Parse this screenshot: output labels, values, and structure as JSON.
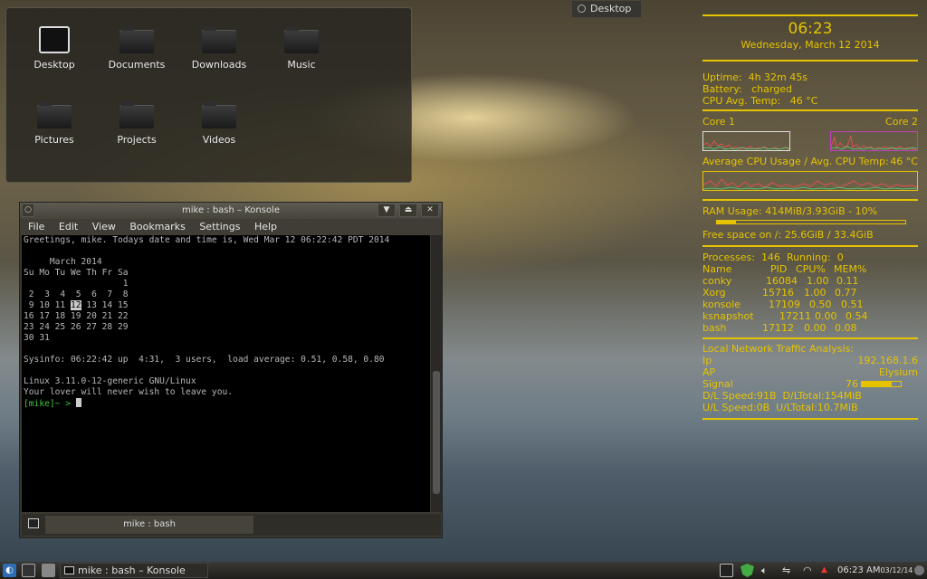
{
  "desktop": {
    "folders": [
      "Desktop",
      "Documents",
      "Downloads",
      "Music",
      "Pictures",
      "Projects",
      "Videos"
    ],
    "pager_label": "Desktop"
  },
  "konsole": {
    "title": "mike : bash – Konsole",
    "menu": [
      "File",
      "Edit",
      "View",
      "Bookmarks",
      "Settings",
      "Help"
    ],
    "tab_label": "mike : bash",
    "lines": {
      "greeting": "Greetings, mike. Todays date and time is, Wed Mar 12 06:22:42 PDT 2014",
      "cal_title": "     March 2014",
      "cal_header": "Su Mo Tu We Th Fr Sa",
      "cal_w1": "                   1",
      "cal_w2": " 2  3  4  5  6  7  8",
      "cal_w3_a": " 9 10 11 ",
      "cal_w3_today": "12",
      "cal_w3_b": " 13 14 15",
      "cal_w4": "16 17 18 19 20 21 22",
      "cal_w5": "23 24 25 26 27 28 29",
      "cal_w6": "30 31",
      "sysinfo": "Sysinfo: 06:22:42 up  4:31,  3 users,  load average: 0.51, 0.58, 0.80",
      "kernel": "Linux 3.11.0-12-generic GNU/Linux",
      "fortune": "Your lover will never wish to leave you.",
      "prompt": "[mike]~ > "
    }
  },
  "conky": {
    "time": "06:23",
    "date": "Wednesday, March 12 2014",
    "uptime_label": "Uptime:",
    "uptime": "4h 32m 45s",
    "battery_label": "Battery:",
    "battery": "charged",
    "cputemp_label": "CPU Avg. Temp:",
    "cputemp": "46 °C",
    "core1": "Core 1",
    "core2": "Core 2",
    "avg_label": "Average CPU Usage / Avg. CPU Temp:",
    "avg_temp": "46 °C",
    "ram_label": "RAM Usage:",
    "ram": "414MiB/3.93GiB - 10%",
    "ram_fraction": 0.1,
    "disk_label": "Free space on /:",
    "disk": "25.6GiB / 33.4GiB",
    "proc_label": "Processes:",
    "proc": "146",
    "running_label": "Running:",
    "running": "0",
    "proc_headers": [
      "Name",
      "PID",
      "CPU%",
      "MEM%"
    ],
    "procs": [
      {
        "name": "conky",
        "pid": "16084",
        "cpu": "1.00",
        "mem": "0.11"
      },
      {
        "name": "Xorg",
        "pid": "15716",
        "cpu": "1.00",
        "mem": "0.77"
      },
      {
        "name": "konsole",
        "pid": "17109",
        "cpu": "0.50",
        "mem": "0.51"
      },
      {
        "name": "ksnapshot",
        "pid": "17211",
        "cpu": "0.00",
        "mem": "0.54"
      },
      {
        "name": "bash",
        "pid": "17112",
        "cpu": "0.00",
        "mem": "0.08"
      }
    ],
    "net_title": "Local Network Traffic Analysis:",
    "ip_label": "Ip",
    "ip": "192.168.1.6",
    "ap_label": "AP",
    "ap": "Elysium",
    "signal_label": "Signal",
    "signal": "76",
    "signal_fraction": 0.76,
    "dl_speed_label": "D/L Speed:",
    "dl_speed": "91B",
    "dl_total_label": "D/LTotal:",
    "dl_total": "154MiB",
    "ul_speed_label": "U/L Speed:",
    "ul_speed": "0B",
    "ul_total_label": "U/LTotal:",
    "ul_total": "10.7MiB"
  },
  "taskbar": {
    "task_label": "mike : bash – Konsole",
    "clock_time": "06:23 AM",
    "clock_date": "03/12/14"
  },
  "colors": {
    "conky": "#e5c300",
    "accent": "#3ec83e"
  }
}
